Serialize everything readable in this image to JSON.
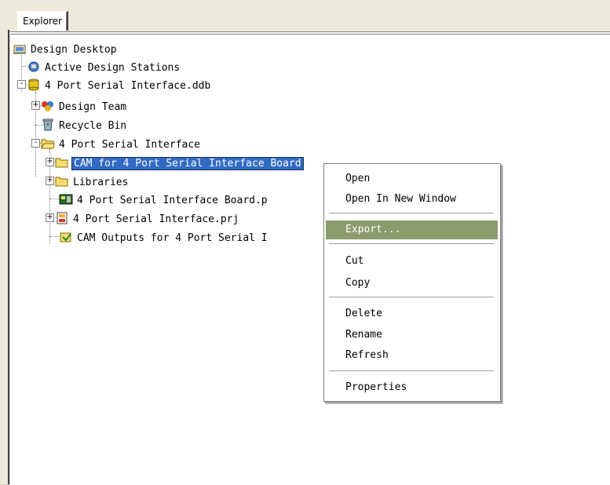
{
  "panel": {
    "tab_label": "Explorer"
  },
  "tree": [
    {
      "label": "Design Desktop",
      "icon": "desktop-icon"
    },
    {
      "label": "Active Design Stations",
      "icon": "stations-icon"
    },
    {
      "label": "4 Port Serial Interface.ddb",
      "icon": "database-icon",
      "expander": "-"
    },
    {
      "label": "Design Team",
      "icon": "team-icon",
      "expander": "+"
    },
    {
      "label": "Recycle Bin",
      "icon": "recycle-bin-icon"
    },
    {
      "label": "4 Port Serial Interface",
      "icon": "folder-open-icon",
      "expander": "-"
    },
    {
      "label": "CAM for 4 Port Serial Interface Board",
      "icon": "folder-icon",
      "expander": "+",
      "selected": true
    },
    {
      "label": "Libraries",
      "icon": "folder-icon",
      "expander": "+"
    },
    {
      "label": "4 Port Serial Interface Board.p",
      "icon": "pcb-document-icon"
    },
    {
      "label": "4 Port Serial Interface.prj",
      "icon": "project-icon",
      "expander": "+"
    },
    {
      "label": "CAM Outputs for 4 Port Serial I",
      "icon": "cam-outputs-icon"
    }
  ],
  "context_menu": {
    "items": [
      {
        "label": "Open"
      },
      {
        "label": "Open In New Window"
      },
      {
        "label": "Export...",
        "highlighted": true
      },
      {
        "label": "Cut"
      },
      {
        "label": "Copy"
      },
      {
        "label": "Delete"
      },
      {
        "label": "Rename"
      },
      {
        "label": "Refresh"
      },
      {
        "label": "Properties"
      }
    ]
  },
  "colors": {
    "menu_highlight": "#8b9b6c",
    "selection": "#316ac5",
    "window_bg": "#d4d0c8"
  }
}
